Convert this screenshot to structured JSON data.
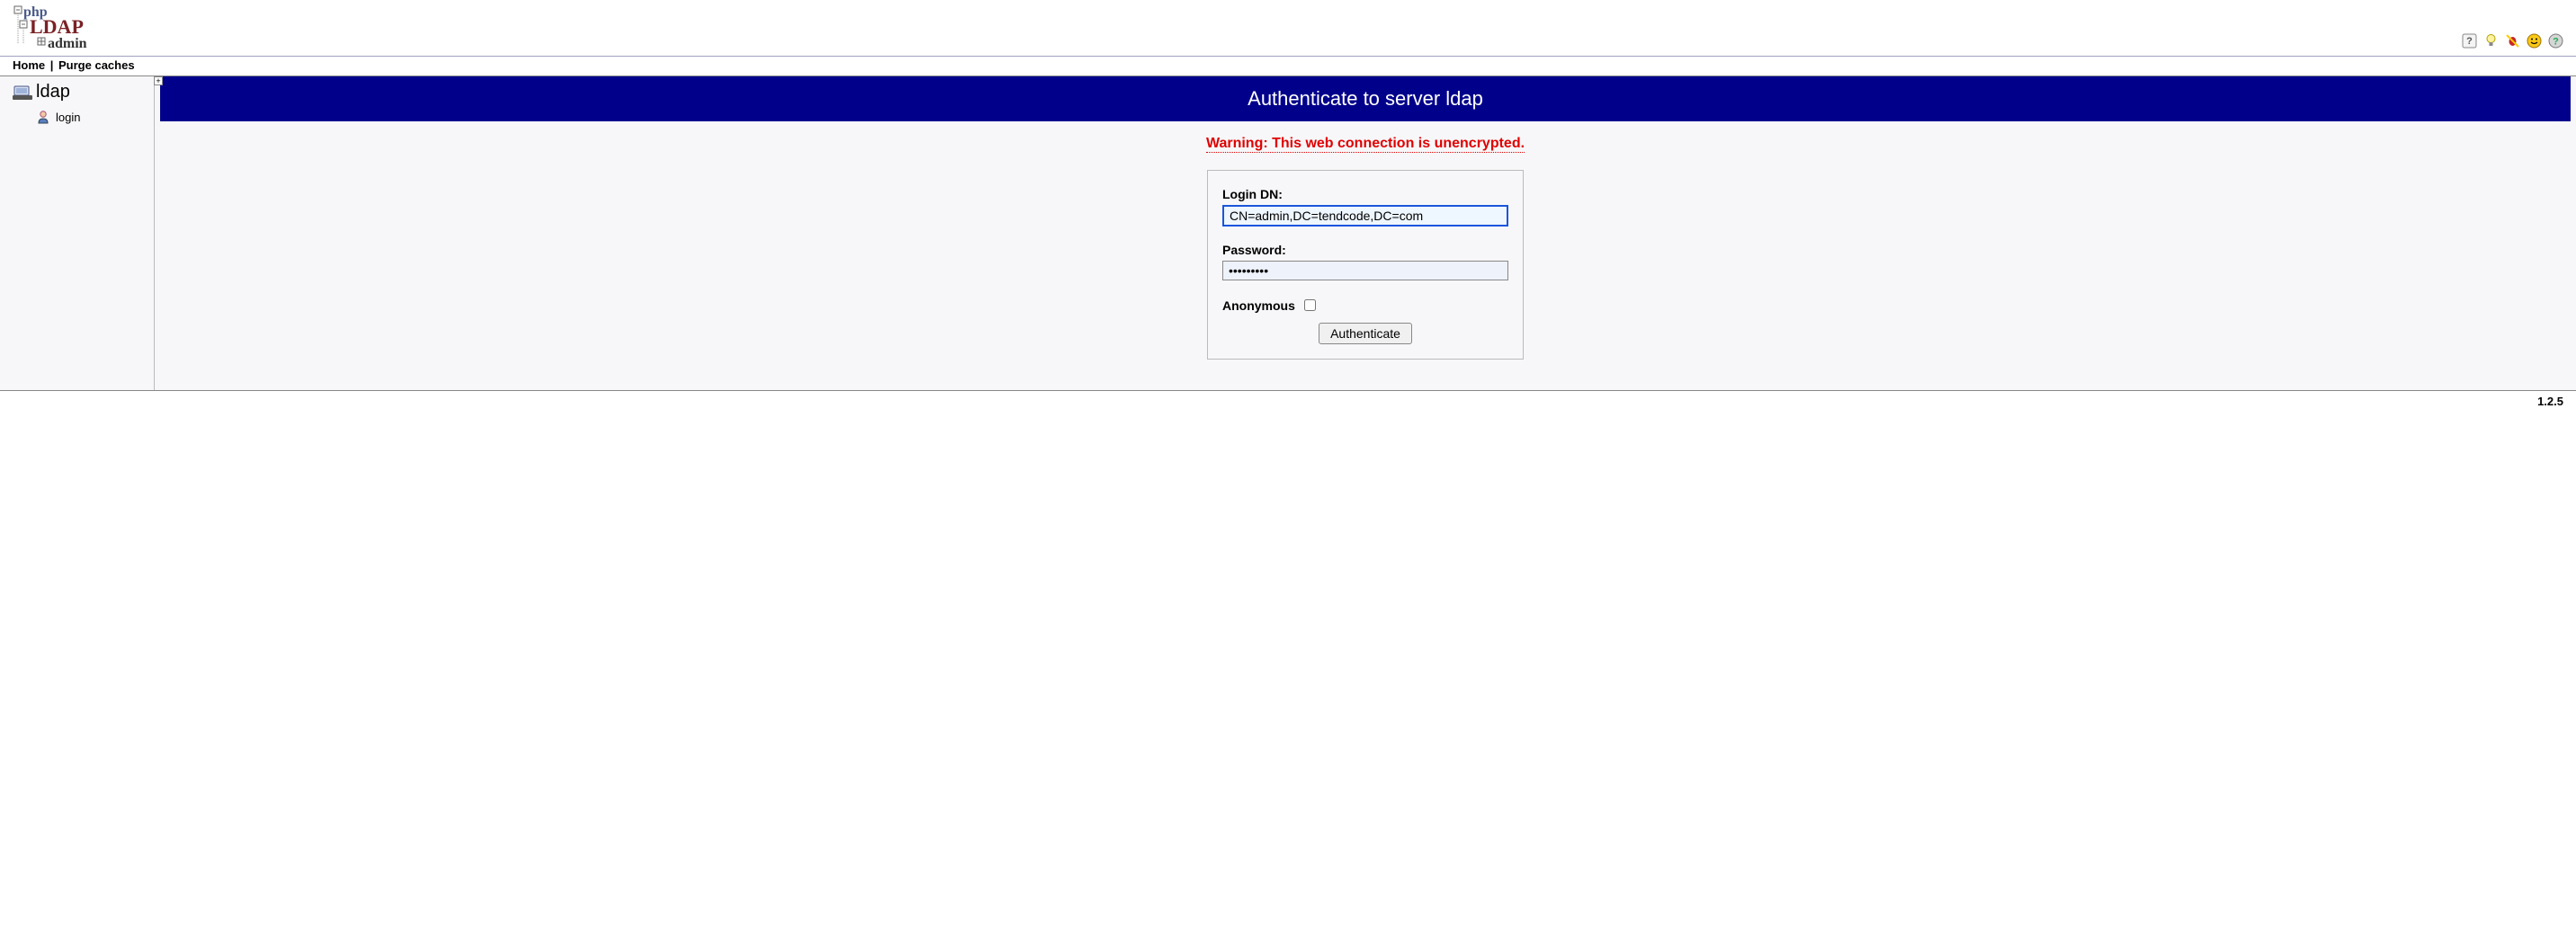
{
  "header": {
    "logo_parts": {
      "php": "php",
      "ldap": "LDAP",
      "admin": "admin"
    },
    "icons": [
      "help-icon",
      "idea-icon",
      "bug-icon",
      "smiley-icon",
      "question-icon"
    ]
  },
  "nav": {
    "home": "Home",
    "purge": "Purge caches",
    "separator": "|"
  },
  "sidebar": {
    "server_label": "ldap",
    "login_label": "login"
  },
  "main": {
    "title": "Authenticate to server ldap",
    "warning": "Warning: This web connection is unencrypted.",
    "form": {
      "login_dn_label": "Login DN:",
      "login_dn_value": "CN=admin,DC=tendcode,DC=com",
      "password_label": "Password:",
      "password_value": "•••••••••",
      "anonymous_label": "Anonymous",
      "anonymous_checked": false,
      "submit_label": "Authenticate"
    }
  },
  "footer": {
    "version": "1.2.5"
  }
}
